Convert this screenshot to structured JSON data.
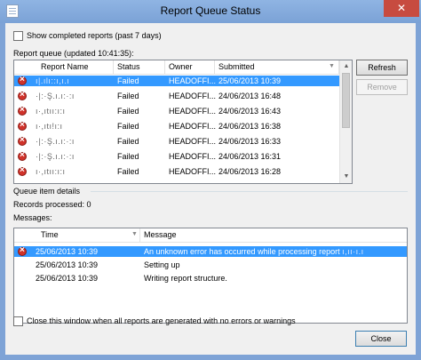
{
  "window": {
    "title": "Report Queue Status",
    "close_glyph": "✕"
  },
  "show_completed": {
    "label": "Show completed reports (past 7 days)",
    "checked": false
  },
  "queue": {
    "label": "Report queue (updated 10:41:35):",
    "columns": [
      "Report Name",
      "Status",
      "Owner",
      "Submitted"
    ],
    "rows": [
      {
        "name": "ı|.ılı::ı,ı.ı",
        "status": "Failed",
        "owner": "HEADOFFI...",
        "submitted": "25/06/2013 10:39",
        "selected": true
      },
      {
        "name": "·|:·Ş.ı.ı:·:ı",
        "status": "Failed",
        "owner": "HEADOFFI...",
        "submitted": "24/06/2013 16:48",
        "selected": false
      },
      {
        "name": "ı·,ıtıı:ı:ı",
        "status": "Failed",
        "owner": "HEADOFFI...",
        "submitted": "24/06/2013 16:43",
        "selected": false
      },
      {
        "name": "ı·,ıtı!ı:ı",
        "status": "Failed",
        "owner": "HEADOFFI...",
        "submitted": "24/06/2013 16:38",
        "selected": false
      },
      {
        "name": "·|:·Ş.ı.ı:·:ı",
        "status": "Failed",
        "owner": "HEADOFFI...",
        "submitted": "24/06/2013 16:33",
        "selected": false
      },
      {
        "name": "·|:·Ş.ı.ı:·:ı",
        "status": "Failed",
        "owner": "HEADOFFI...",
        "submitted": "24/06/2013 16:31",
        "selected": false
      },
      {
        "name": "ı·,ıtıı:ı:ı",
        "status": "Failed",
        "owner": "HEADOFFI...",
        "submitted": "24/06/2013 16:28",
        "selected": false
      }
    ]
  },
  "buttons": {
    "refresh": "Refresh",
    "remove": "Remove",
    "close": "Close"
  },
  "details": {
    "label": "Queue item details",
    "records": "Records processed: 0",
    "messages_label": "Messages:"
  },
  "messages": {
    "columns": [
      "Time",
      "Message"
    ],
    "rows": [
      {
        "time": "25/06/2013 10:39",
        "message": "An unknown error has occurred while processing report ",
        "tail": "ı,ıı·ı.ı",
        "error": true,
        "selected": true
      },
      {
        "time": "25/06/2013 10:39",
        "message": "Setting up",
        "tail": "",
        "error": false,
        "selected": false
      },
      {
        "time": "25/06/2013 10:39",
        "message": "Writing report structure.",
        "tail": "",
        "error": false,
        "selected": false
      }
    ]
  },
  "close_when_done": {
    "label": "Close this window when all reports are generated with no errors or warnings",
    "checked": false
  },
  "colors": {
    "selection": "#3399ff",
    "titlebar": "#7ba2d6",
    "close": "#c74b40",
    "error_icon": "#d0322a"
  },
  "icons": {
    "error": "error-icon",
    "sort": "sort-down-icon"
  }
}
